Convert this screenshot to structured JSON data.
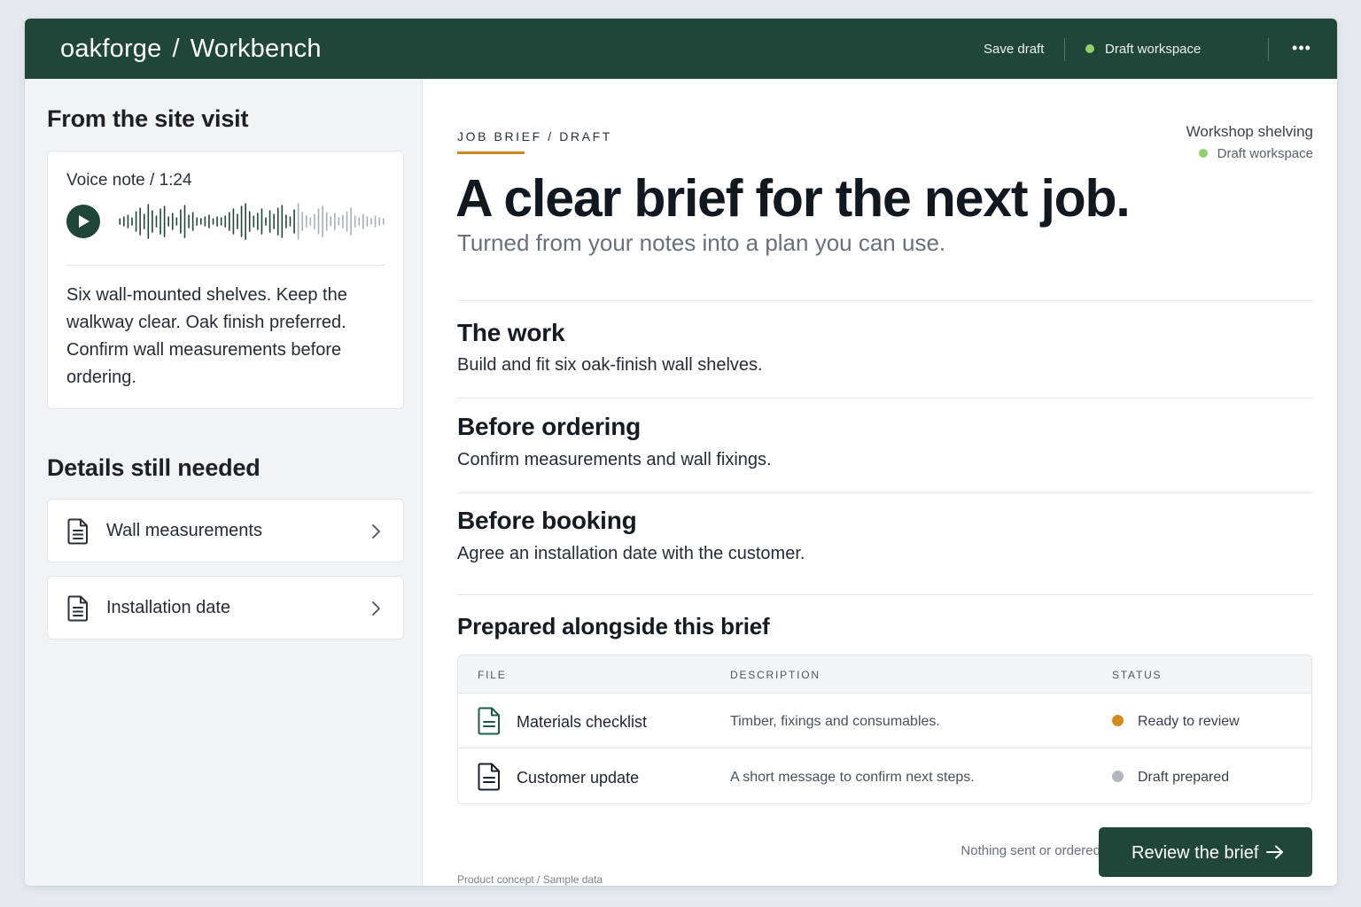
{
  "topbar": {
    "brand": "oakforge",
    "separator": "/",
    "workspace": "Workbench",
    "save_label": "Save draft",
    "status_label": "Draft workspace",
    "more_label": "•••"
  },
  "left": {
    "site_visit_title": "From the site visit",
    "voice_note": {
      "label": "Voice note / 1:24",
      "transcript": "Six wall-mounted shelves. Keep the walkway clear. Oak finish preferred. Confirm wall measurements before ordering."
    },
    "details_title": "Details still needed",
    "details": [
      {
        "label": "Wall measurements",
        "icon": "document-icon"
      },
      {
        "label": "Installation date",
        "icon": "document-icon"
      }
    ]
  },
  "main": {
    "eyebrow": "JOB BRIEF  /  DRAFT",
    "project": "Workshop shelving",
    "status": "Draft workspace",
    "headline": "A clear brief for the next job.",
    "subhead": "Turned from your notes into a plan you can use.",
    "sections": [
      {
        "title": "The work",
        "text": "Build and fit six oak-finish wall shelves."
      },
      {
        "title": "Before ordering",
        "text": "Confirm measurements and wall fixings."
      },
      {
        "title": "Before booking",
        "text": "Agree an installation date with the customer."
      }
    ],
    "files": {
      "title": "Prepared alongside this brief",
      "headers": [
        "FILE",
        "DESCRIPTION",
        "STATUS"
      ],
      "rows": [
        {
          "name": "Materials checklist",
          "description": "Timber, fixings and consumables.",
          "status": "Ready to review",
          "status_color": "#d48a1e"
        },
        {
          "name": "Customer update",
          "description": "A short message to confirm next steps.",
          "status": "Draft prepared",
          "status_color": "#b4b8bd"
        }
      ]
    },
    "nothing_sent": "Nothing sent or ordered",
    "review_button": "Review the brief",
    "footnote": "Product concept / Sample data"
  },
  "colors": {
    "brand_green": "#1f4638",
    "status_green": "#8fd16a",
    "accent_amber": "#c98a22"
  }
}
